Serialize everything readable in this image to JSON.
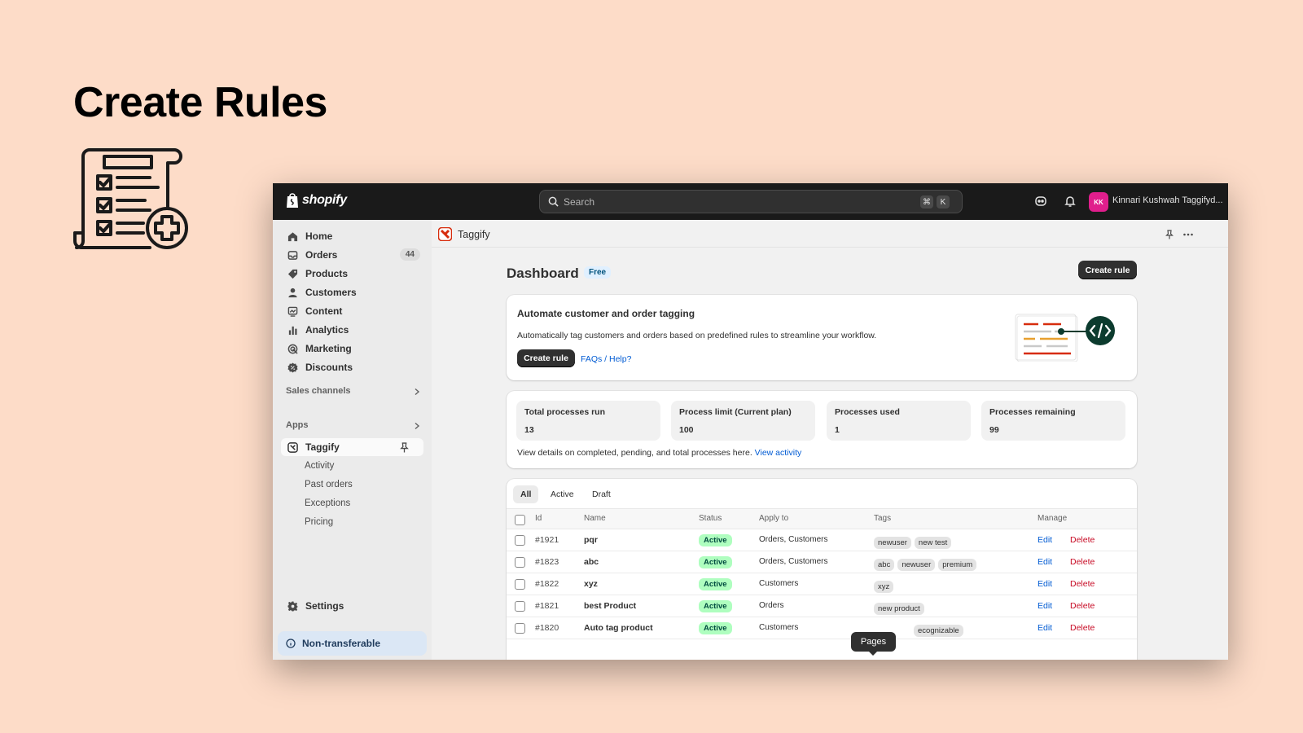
{
  "slide": {
    "title": "Create Rules"
  },
  "topbar": {
    "brand": "shopify",
    "search_placeholder": "Search",
    "shortcut_keys": [
      "⌘",
      "K"
    ],
    "avatar_initials": "KK",
    "store_name": "Kinnari Kushwah Taggifyd..."
  },
  "sidebar": {
    "items": [
      {
        "label": "Home",
        "icon": "home-icon"
      },
      {
        "label": "Orders",
        "icon": "orders-icon",
        "count": "44"
      },
      {
        "label": "Products",
        "icon": "products-icon"
      },
      {
        "label": "Customers",
        "icon": "customers-icon"
      },
      {
        "label": "Content",
        "icon": "content-icon"
      },
      {
        "label": "Analytics",
        "icon": "analytics-icon"
      },
      {
        "label": "Marketing",
        "icon": "marketing-icon"
      },
      {
        "label": "Discounts",
        "icon": "discounts-icon"
      }
    ],
    "sales_channels_label": "Sales channels",
    "apps_label": "Apps",
    "app_name": "Taggify",
    "app_subitems": [
      "Activity",
      "Past orders",
      "Exceptions",
      "Pricing"
    ],
    "settings_label": "Settings",
    "non_transferable_label": "Non-transferable"
  },
  "appbar": {
    "title": "Taggify"
  },
  "dashboard": {
    "title": "Dashboard",
    "plan_badge": "Free",
    "create_rule_label": "Create rule",
    "intro": {
      "heading": "Automate customer and order tagging",
      "description": "Automatically tag customers and orders based on predefined rules to streamline your workflow.",
      "create_rule_label": "Create rule",
      "faq_label": "FAQs / Help?"
    },
    "stats": [
      {
        "label": "Total processes run",
        "value": "13"
      },
      {
        "label": "Process limit (Current plan)",
        "value": "100"
      },
      {
        "label": "Processes used",
        "value": "1"
      },
      {
        "label": "Processes remaining",
        "value": "99"
      }
    ],
    "stats_note": "View details on completed, pending, and total processes here.",
    "view_activity_label": "View activity"
  },
  "rules_table": {
    "tabs": [
      "All",
      "Active",
      "Draft"
    ],
    "columns": [
      "Id",
      "Name",
      "Status",
      "Apply to",
      "Tags",
      "Manage"
    ],
    "rows": [
      {
        "id": "#1921",
        "name": "pqr",
        "status": "Active",
        "apply_to": "Orders, Customers",
        "tags": [
          "newuser",
          "new test"
        ]
      },
      {
        "id": "#1823",
        "name": "abc",
        "status": "Active",
        "apply_to": "Orders, Customers",
        "tags": [
          "abc",
          "newuser",
          "premium"
        ]
      },
      {
        "id": "#1822",
        "name": "xyz",
        "status": "Active",
        "apply_to": "Customers",
        "tags": [
          "xyz"
        ]
      },
      {
        "id": "#1821",
        "name": "best Product",
        "status": "Active",
        "apply_to": "Orders",
        "tags": [
          "new product"
        ]
      },
      {
        "id": "#1820",
        "name": "Auto tag product",
        "status": "Active",
        "apply_to": "Customers",
        "tags": [
          "ecognizable"
        ]
      }
    ],
    "edit_label": "Edit",
    "delete_label": "Delete"
  },
  "tooltip": {
    "label": "Pages"
  }
}
